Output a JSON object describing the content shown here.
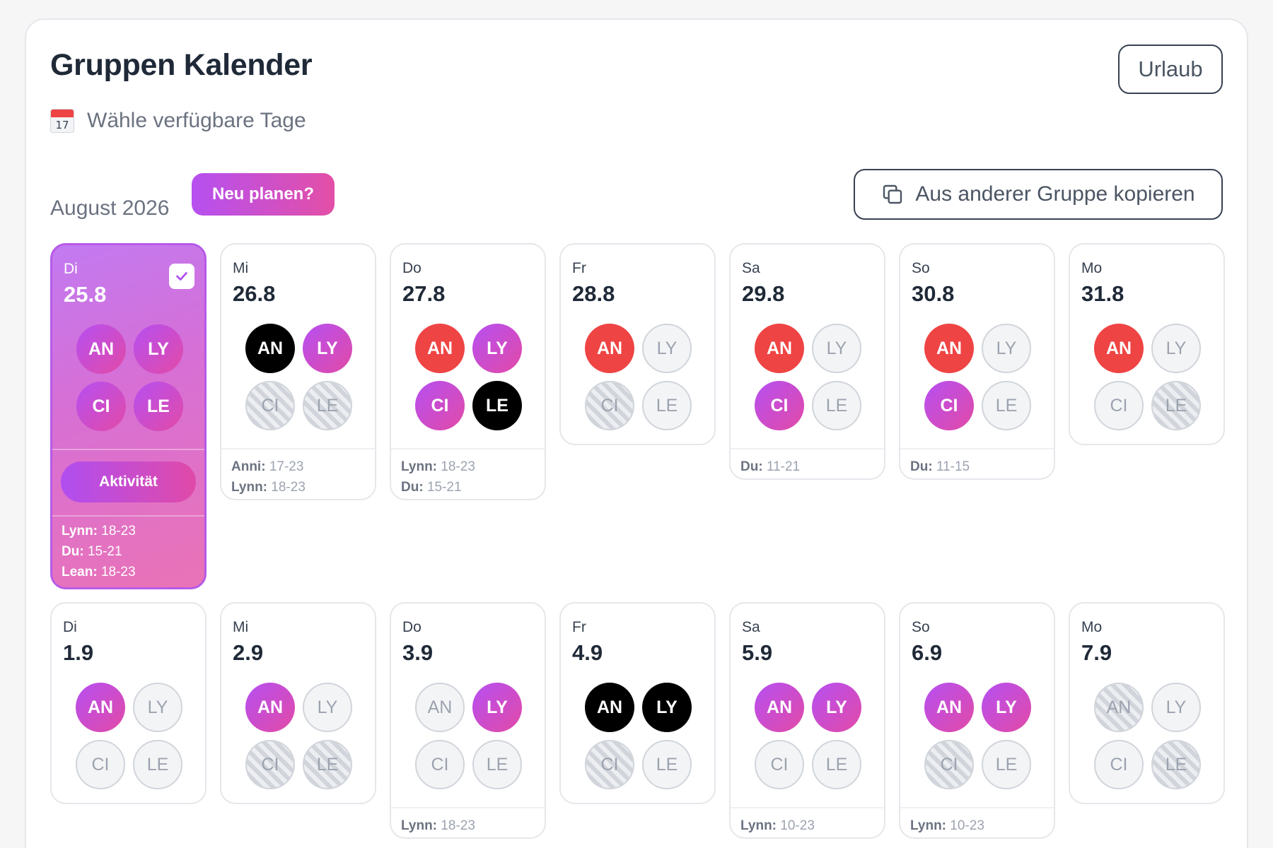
{
  "header": {
    "title": "Gruppen Kalender",
    "urlaub_label": "Urlaub",
    "subtitle": "Wähle verfügbare Tage",
    "calendar_icon_number": "17"
  },
  "toolbar": {
    "month": "August 2026",
    "replan_label": "Neu planen?",
    "copy_label": "Aus anderer Gruppe kopieren"
  },
  "selected_day": {
    "activity_label": "Aktivität"
  },
  "days": [
    {
      "dow": "Di",
      "date": "25.8",
      "selected": true,
      "members": [
        {
          "code": "AN",
          "state": "purple"
        },
        {
          "code": "LY",
          "state": "purple"
        },
        {
          "code": "CI",
          "state": "purple"
        },
        {
          "code": "LE",
          "state": "purple"
        }
      ],
      "notes": [
        {
          "name": "Lynn:",
          "time": "18-23"
        },
        {
          "name": "Du:",
          "time": "15-21"
        },
        {
          "name": "Lean:",
          "time": "18-23"
        }
      ]
    },
    {
      "dow": "Mi",
      "date": "26.8",
      "members": [
        {
          "code": "AN",
          "state": "black"
        },
        {
          "code": "LY",
          "state": "purple"
        },
        {
          "code": "CI",
          "state": "striped"
        },
        {
          "code": "LE",
          "state": "striped"
        }
      ],
      "notes": [
        {
          "name": "Anni:",
          "time": "17-23"
        },
        {
          "name": "Lynn:",
          "time": "18-23"
        }
      ]
    },
    {
      "dow": "Do",
      "date": "27.8",
      "members": [
        {
          "code": "AN",
          "state": "red"
        },
        {
          "code": "LY",
          "state": "purple"
        },
        {
          "code": "CI",
          "state": "purple"
        },
        {
          "code": "LE",
          "state": "black"
        }
      ],
      "notes": [
        {
          "name": "Lynn:",
          "time": "18-23"
        },
        {
          "name": "Du:",
          "time": "15-21"
        }
      ]
    },
    {
      "dow": "Fr",
      "date": "28.8",
      "members": [
        {
          "code": "AN",
          "state": "red"
        },
        {
          "code": "LY",
          "state": "empty"
        },
        {
          "code": "CI",
          "state": "striped"
        },
        {
          "code": "LE",
          "state": "empty"
        }
      ],
      "notes": []
    },
    {
      "dow": "Sa",
      "date": "29.8",
      "members": [
        {
          "code": "AN",
          "state": "red"
        },
        {
          "code": "LY",
          "state": "empty"
        },
        {
          "code": "CI",
          "state": "purple"
        },
        {
          "code": "LE",
          "state": "empty"
        }
      ],
      "notes": [
        {
          "name": "Du:",
          "time": "11-21"
        }
      ]
    },
    {
      "dow": "So",
      "date": "30.8",
      "members": [
        {
          "code": "AN",
          "state": "red"
        },
        {
          "code": "LY",
          "state": "empty"
        },
        {
          "code": "CI",
          "state": "purple"
        },
        {
          "code": "LE",
          "state": "empty"
        }
      ],
      "notes": [
        {
          "name": "Du:",
          "time": "11-15"
        }
      ]
    },
    {
      "dow": "Mo",
      "date": "31.8",
      "members": [
        {
          "code": "AN",
          "state": "red"
        },
        {
          "code": "LY",
          "state": "empty"
        },
        {
          "code": "CI",
          "state": "empty"
        },
        {
          "code": "LE",
          "state": "striped"
        }
      ],
      "notes": []
    },
    {
      "dow": "Di",
      "date": "1.9",
      "members": [
        {
          "code": "AN",
          "state": "purple"
        },
        {
          "code": "LY",
          "state": "empty"
        },
        {
          "code": "CI",
          "state": "empty"
        },
        {
          "code": "LE",
          "state": "empty"
        }
      ],
      "notes": []
    },
    {
      "dow": "Mi",
      "date": "2.9",
      "members": [
        {
          "code": "AN",
          "state": "purple"
        },
        {
          "code": "LY",
          "state": "empty"
        },
        {
          "code": "CI",
          "state": "striped"
        },
        {
          "code": "LE",
          "state": "striped"
        }
      ],
      "notes": []
    },
    {
      "dow": "Do",
      "date": "3.9",
      "members": [
        {
          "code": "AN",
          "state": "empty"
        },
        {
          "code": "LY",
          "state": "purple"
        },
        {
          "code": "CI",
          "state": "empty"
        },
        {
          "code": "LE",
          "state": "empty"
        }
      ],
      "notes": [
        {
          "name": "Lynn:",
          "time": "18-23"
        }
      ]
    },
    {
      "dow": "Fr",
      "date": "4.9",
      "members": [
        {
          "code": "AN",
          "state": "black"
        },
        {
          "code": "LY",
          "state": "black"
        },
        {
          "code": "CI",
          "state": "striped"
        },
        {
          "code": "LE",
          "state": "empty"
        }
      ],
      "notes": []
    },
    {
      "dow": "Sa",
      "date": "5.9",
      "members": [
        {
          "code": "AN",
          "state": "purple"
        },
        {
          "code": "LY",
          "state": "purple"
        },
        {
          "code": "CI",
          "state": "empty"
        },
        {
          "code": "LE",
          "state": "empty"
        }
      ],
      "notes": [
        {
          "name": "Lynn:",
          "time": "10-23"
        }
      ]
    },
    {
      "dow": "So",
      "date": "6.9",
      "members": [
        {
          "code": "AN",
          "state": "purple"
        },
        {
          "code": "LY",
          "state": "purple"
        },
        {
          "code": "CI",
          "state": "striped"
        },
        {
          "code": "LE",
          "state": "empty"
        }
      ],
      "notes": [
        {
          "name": "Lynn:",
          "time": "10-23"
        }
      ]
    },
    {
      "dow": "Mo",
      "date": "7.9",
      "members": [
        {
          "code": "AN",
          "state": "striped"
        },
        {
          "code": "LY",
          "state": "empty"
        },
        {
          "code": "CI",
          "state": "empty"
        },
        {
          "code": "LE",
          "state": "striped"
        }
      ],
      "notes": []
    }
  ]
}
